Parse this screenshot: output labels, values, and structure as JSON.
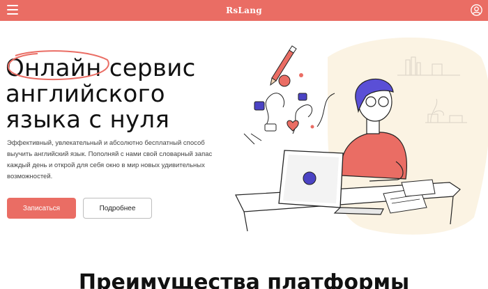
{
  "header": {
    "brand": "RsLang",
    "menu_icon": "hamburger-menu-icon",
    "profile_icon": "user-profile-icon",
    "background": "#ea6d64"
  },
  "hero": {
    "title_lines": [
      "Онлайн сервис",
      "английского",
      "языка с нуля"
    ],
    "description": "Эффективный, увлекательный и абсолютно бесплатный способ выучить английский язык. Пополняй с нами свой словарный запас каждый день и открой для себя окно в мир новых удивительных возможностей.",
    "primary_button": "Записаться",
    "secondary_button": "Подробнее",
    "accent_color": "#ea6d64"
  },
  "sections": {
    "advantages_title": "Преимущества платформы"
  }
}
